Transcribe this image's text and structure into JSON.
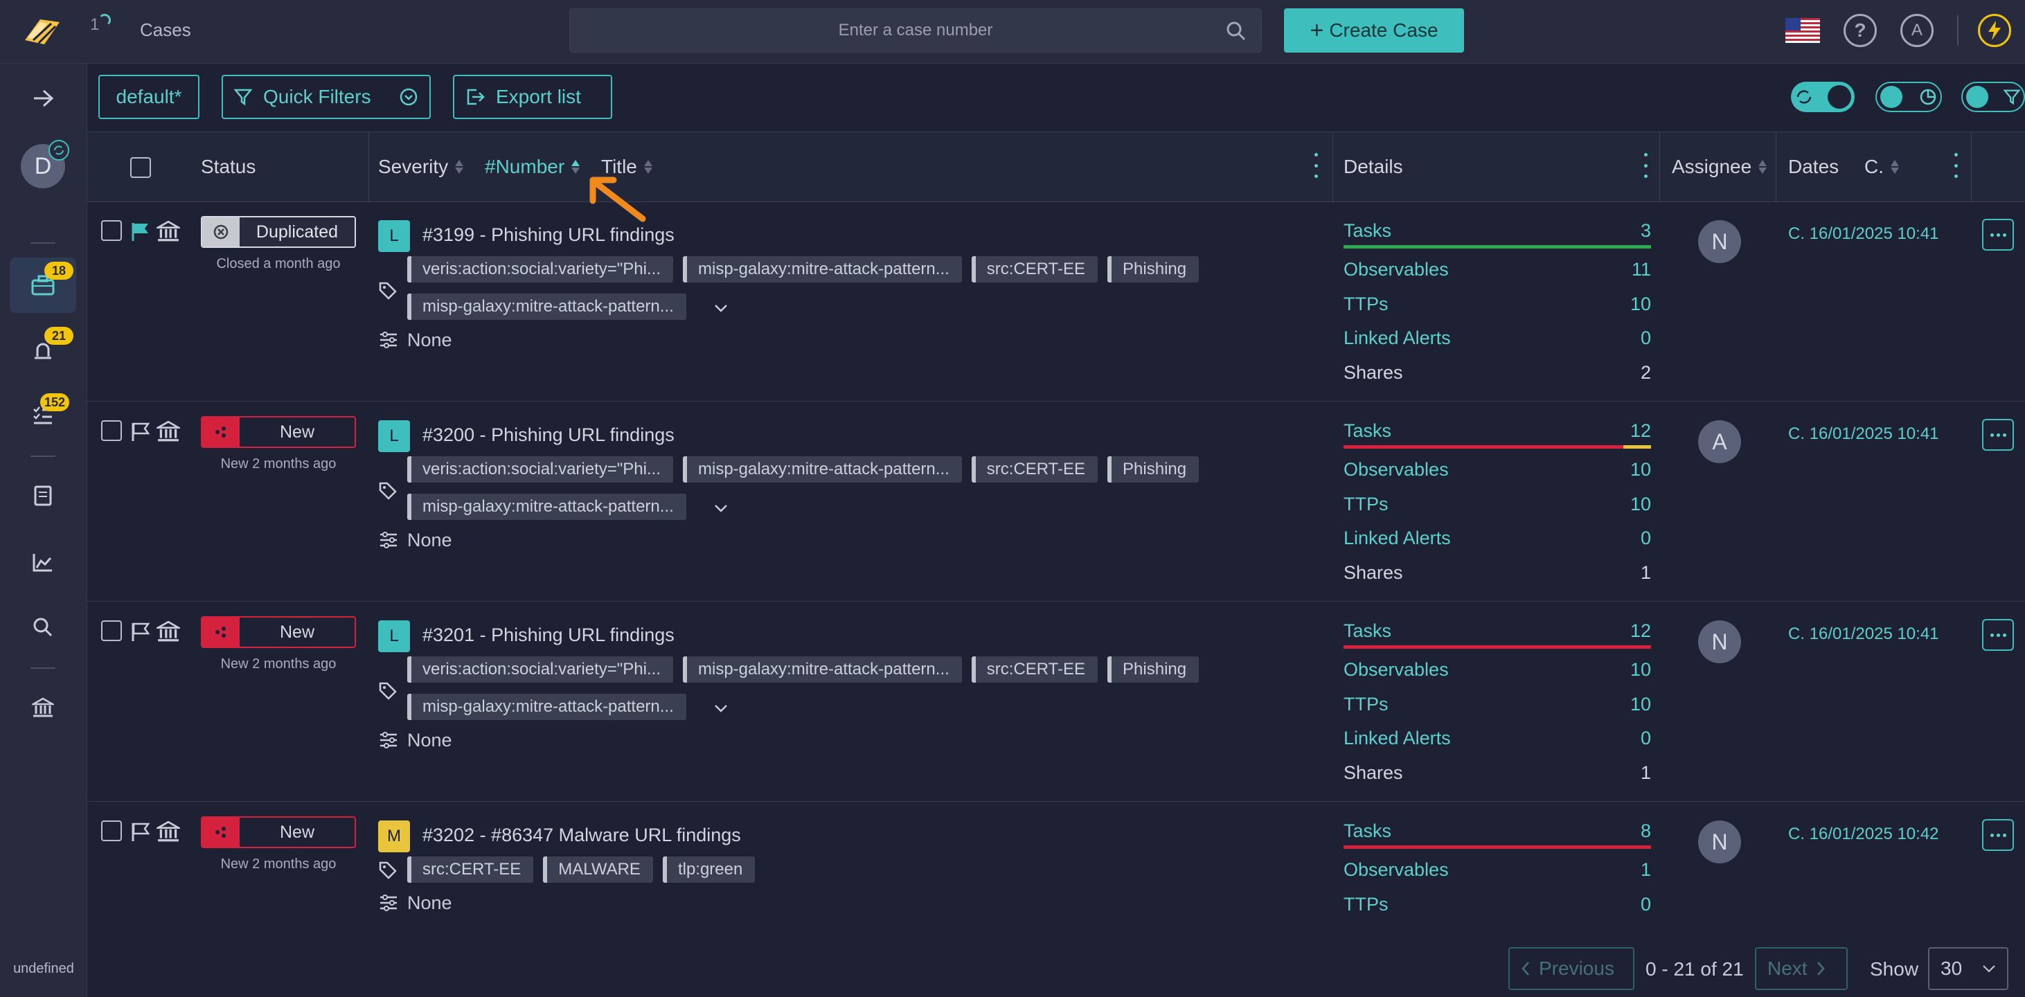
{
  "app": {
    "breadcrumb_count": "1",
    "breadcrumb_title": "Cases",
    "footer_label": "undefined"
  },
  "search": {
    "placeholder": "Enter a case number"
  },
  "header": {
    "create_label": "Create Case"
  },
  "sidebar": {
    "badges": {
      "cases": "18",
      "alerts": "21",
      "tasks": "152"
    },
    "avatar_initial": "D"
  },
  "user": {
    "initial": "A"
  },
  "toolbar": {
    "filter_preset": "default*",
    "quick_filters": "Quick Filters",
    "export": "Export list"
  },
  "table": {
    "columns": {
      "status": "Status",
      "severity": "Severity",
      "number": "#Number",
      "title": "Title",
      "details": "Details",
      "assignee": "Assignee",
      "dates": "Dates",
      "c": "C."
    },
    "rows": [
      {
        "status": "Duplicated",
        "status_sub": "Closed a month ago",
        "severity": "L",
        "title": "#3199 - Phishing URL findings",
        "tags": [
          "veris:action:social:variety=\"Phi...",
          "misp-galaxy:mitre-attack-pattern...",
          "src:CERT-EE",
          "Phishing"
        ],
        "tags2": [
          "misp-galaxy:mitre-attack-pattern..."
        ],
        "custom": "None",
        "details": {
          "tasks_label": "Tasks",
          "tasks": "3",
          "observables_label": "Observables",
          "observables": "11",
          "ttps_label": "TTPs",
          "ttps": "10",
          "linked_label": "Linked Alerts",
          "linked": "0",
          "shares_label": "Shares",
          "shares": "2"
        },
        "assignee": "N",
        "date": "C. 16/01/2025 10:41"
      },
      {
        "status": "New",
        "status_sub": "New 2 months ago",
        "severity": "L",
        "title": "#3200 - Phishing URL findings",
        "tags": [
          "veris:action:social:variety=\"Phi...",
          "misp-galaxy:mitre-attack-pattern...",
          "src:CERT-EE",
          "Phishing"
        ],
        "tags2": [
          "misp-galaxy:mitre-attack-pattern..."
        ],
        "custom": "None",
        "details": {
          "tasks_label": "Tasks",
          "tasks": "12",
          "observables_label": "Observables",
          "observables": "10",
          "ttps_label": "TTPs",
          "ttps": "10",
          "linked_label": "Linked Alerts",
          "linked": "0",
          "shares_label": "Shares",
          "shares": "1"
        },
        "assignee": "A",
        "date": "C. 16/01/2025 10:41"
      },
      {
        "status": "New",
        "status_sub": "New 2 months ago",
        "severity": "L",
        "title": "#3201 - Phishing URL findings",
        "tags": [
          "veris:action:social:variety=\"Phi...",
          "misp-galaxy:mitre-attack-pattern...",
          "src:CERT-EE",
          "Phishing"
        ],
        "tags2": [
          "misp-galaxy:mitre-attack-pattern..."
        ],
        "custom": "None",
        "details": {
          "tasks_label": "Tasks",
          "tasks": "12",
          "observables_label": "Observables",
          "observables": "10",
          "ttps_label": "TTPs",
          "ttps": "10",
          "linked_label": "Linked Alerts",
          "linked": "0",
          "shares_label": "Shares",
          "shares": "1"
        },
        "assignee": "N",
        "date": "C. 16/01/2025 10:41"
      },
      {
        "status": "New",
        "status_sub": "New 2 months ago",
        "severity": "M",
        "title": "#3202 - #86347 Malware URL findings",
        "tags": [
          "src:CERT-EE",
          "MALWARE",
          "tlp:green"
        ],
        "custom": "None",
        "details": {
          "tasks_label": "Tasks",
          "tasks": "8",
          "observables_label": "Observables",
          "observables": "1",
          "ttps_label": "TTPs",
          "ttps": "0"
        },
        "assignee": "N",
        "date": "C. 16/01/2025 10:42"
      }
    ]
  },
  "pagination": {
    "previous": "Previous",
    "next": "Next",
    "range": "0 - 21 of 21",
    "show_label": "Show",
    "page_size": "30"
  },
  "colors": {
    "accent": "#3ebfbd",
    "new_red": "#d4213d",
    "badge_yellow": "#f1c40f",
    "task_green": "#2fa84f"
  }
}
